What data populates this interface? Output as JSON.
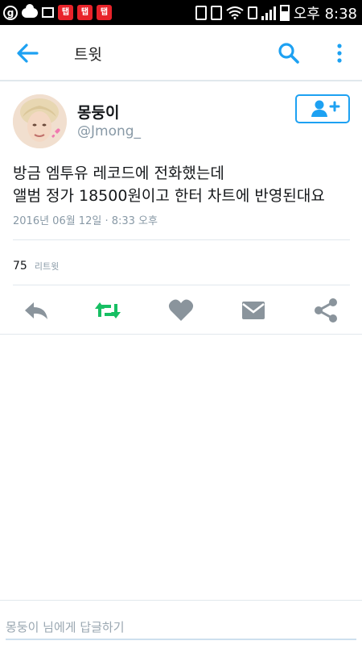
{
  "status_bar": {
    "notif_circle": "g",
    "badges": [
      "탭",
      "탭",
      "탭"
    ],
    "time": "오후 8:38"
  },
  "appbar": {
    "title": "트윗",
    "accent_color": "#1da1f2"
  },
  "tweet": {
    "author_name": "몽둥이",
    "author_handle": "@Jmong_",
    "text": "방금 엠투유 레코드에 전화했는데\n앨범 정가 18500원이고 한터 차트에 반영된대요",
    "timestamp": "2016년 06월 12일 · 8:33 오후",
    "retweet_count": "75",
    "retweet_label": "리트윗",
    "actions": [
      "reply-icon",
      "retweet-icon",
      "like-icon",
      "message-icon",
      "share-icon"
    ]
  },
  "reply": {
    "placeholder": "몽둥이 님에게 답글하기"
  },
  "colors": {
    "retweet_active": "#17bf63",
    "icon_gray": "#8a949c"
  }
}
